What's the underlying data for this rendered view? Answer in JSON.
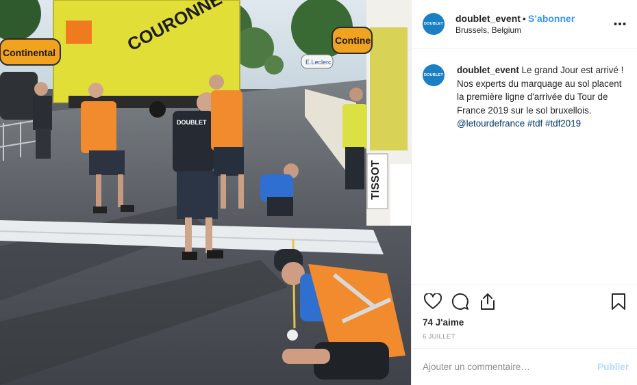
{
  "post": {
    "username": "doublet_event",
    "avatar_text": "DOUBLET",
    "separator": "•",
    "follow_label": "S’abonner",
    "location": "Brussels, Belgium",
    "more_icon": "more-horizontal-icon"
  },
  "caption": {
    "username": "doublet_event",
    "text": "Le grand Jour est arrivé ! Nos experts du marquage au sol placent la première ligne d'arrivée du Tour de France 2019 sur le sol bruxellois.",
    "hashtags": "@letourdefrance #tdf #tdf2019"
  },
  "photo": {
    "banner_left": "Continental",
    "banner_right": "Contine",
    "truck_text": "COURONNE",
    "vest_text": "DOUBLET",
    "sign_text": "TISSOT",
    "leclerc": "E.Leclerc"
  },
  "actions": {
    "icons": [
      "heart-icon",
      "comment-icon",
      "share-icon",
      "bookmark-icon"
    ],
    "likes": "74 J'aime",
    "date": "6 JUILLET"
  },
  "comment_box": {
    "placeholder": "Ajouter un commentaire…",
    "publish_label": "Publier"
  },
  "colors": {
    "accent": "#3897f0",
    "avatar": "#1b7fc3",
    "hashtag": "#003569",
    "publish_disabled": "#b3dbff",
    "vest_orange": "#f28a2e",
    "truck_yellow": "#e6e23a"
  }
}
